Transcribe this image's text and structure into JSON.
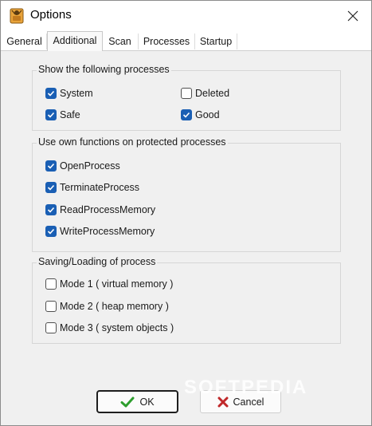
{
  "window": {
    "title": "Options",
    "close_icon": "close-icon"
  },
  "tabs": [
    {
      "label": "General"
    },
    {
      "label": "Additional"
    },
    {
      "label": "Scan"
    },
    {
      "label": "Processes"
    },
    {
      "label": "Startup"
    }
  ],
  "active_tab": "Additional",
  "groups": {
    "show_processes": {
      "title": "Show the following processes",
      "options": [
        {
          "label": "System",
          "checked": true
        },
        {
          "label": "Deleted",
          "checked": false
        },
        {
          "label": "Safe",
          "checked": true
        },
        {
          "label": "Good",
          "checked": true
        }
      ]
    },
    "own_functions": {
      "title": "Use own functions on protected processes",
      "options": [
        {
          "label": "OpenProcess",
          "checked": true
        },
        {
          "label": "TerminateProcess",
          "checked": true
        },
        {
          "label": "ReadProcessMemory",
          "checked": true
        },
        {
          "label": "WriteProcessMemory",
          "checked": true
        }
      ]
    },
    "saving_loading": {
      "title": "Saving/Loading of process",
      "options": [
        {
          "label": "Mode 1 ( virtual memory )",
          "checked": false
        },
        {
          "label": "Mode 2 ( heap memory )",
          "checked": false
        },
        {
          "label": "Mode 3 ( system objects )",
          "checked": false
        }
      ]
    }
  },
  "buttons": {
    "ok_label": "OK",
    "cancel_label": "Cancel"
  },
  "watermark": "SOFTPEDIA",
  "colors": {
    "accent": "#1a5fb4",
    "ok_check": "#2e9e2e",
    "cancel_x": "#c0282a"
  }
}
